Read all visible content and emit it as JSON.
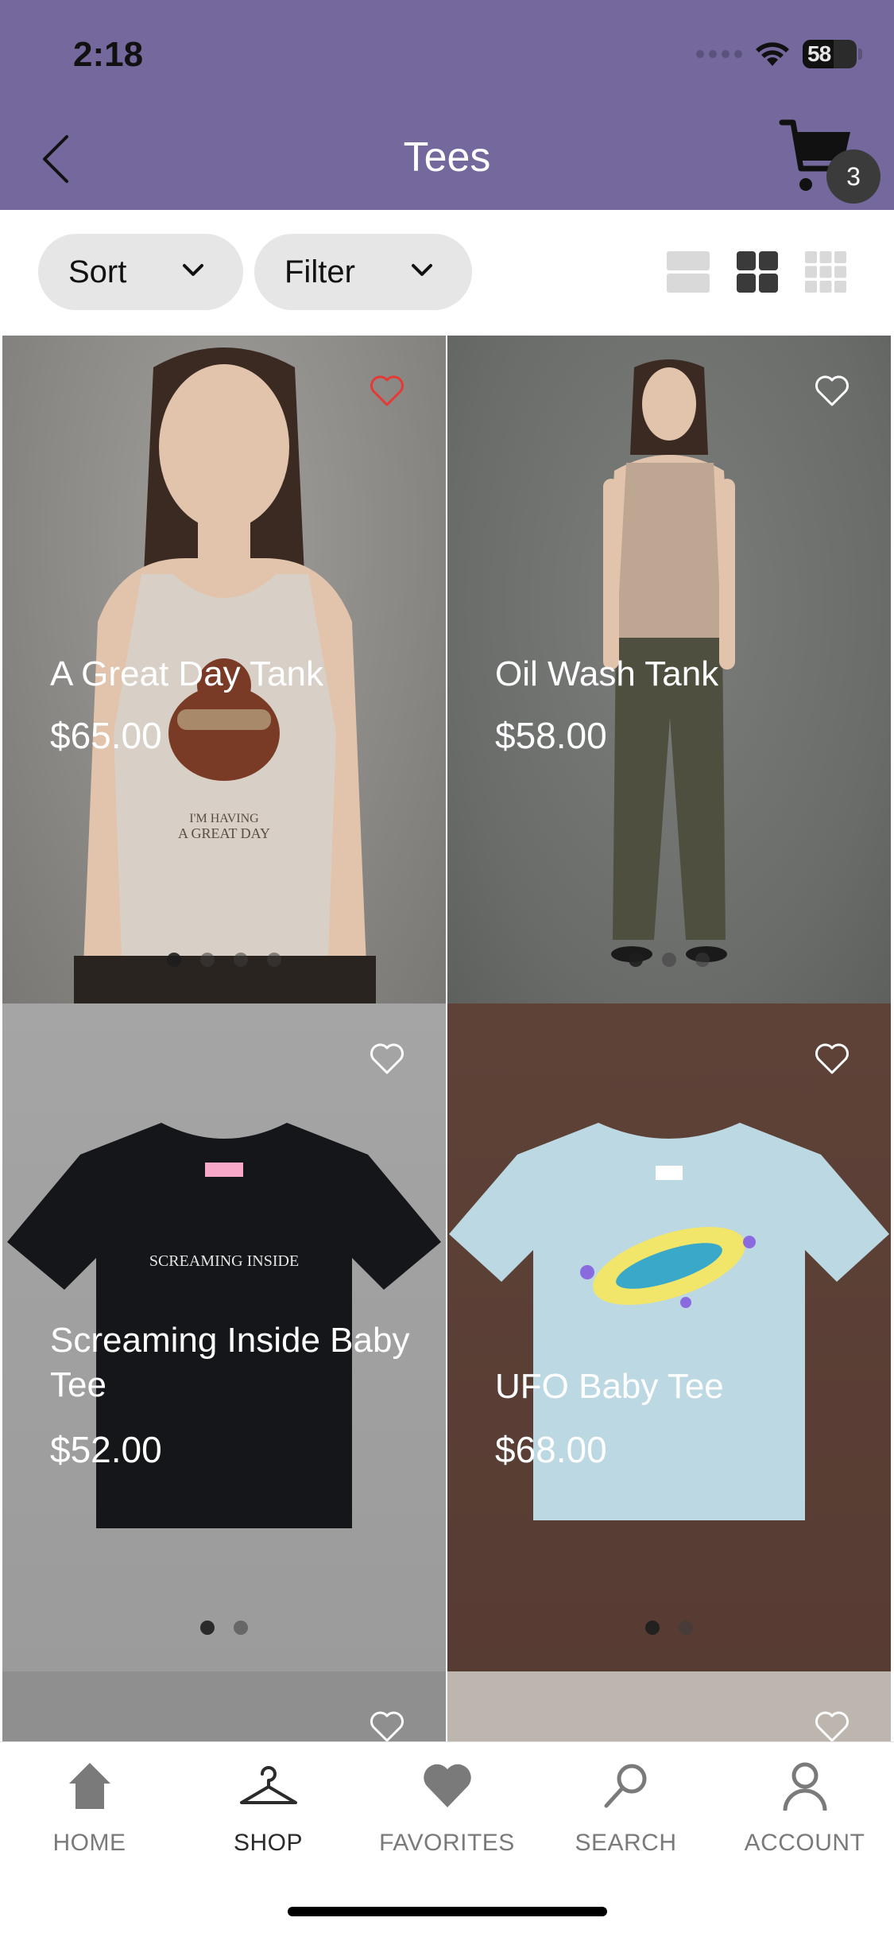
{
  "status_bar": {
    "time": "2:18",
    "battery": "58"
  },
  "header": {
    "title": "Tees",
    "cart_count": "3",
    "back_icon": "chevron-left-icon",
    "cart_icon": "cart-icon"
  },
  "toolbar": {
    "sort_label": "Sort",
    "filter_label": "Filter",
    "view_modes": [
      "single-column-view-icon",
      "two-column-grid-icon",
      "three-column-grid-icon"
    ],
    "active_view": "two-column-grid-icon"
  },
  "products": [
    {
      "name": "A Great Day Tank",
      "price": "$65.00",
      "favorited": true,
      "image_slides": 4,
      "active_slide": 1,
      "bg_color": "#8d8b87"
    },
    {
      "name": "Oil Wash Tank",
      "price": "$58.00",
      "favorited": false,
      "image_slides": 3,
      "active_slide": 1,
      "bg_color": "#6f716f"
    },
    {
      "name": "Screaming Inside Baby Tee",
      "price": "$52.00",
      "favorited": false,
      "image_slides": 2,
      "active_slide": 1,
      "bg_color": "#9f9f9f"
    },
    {
      "name": "UFO Baby Tee",
      "price": "$68.00",
      "favorited": false,
      "image_slides": 2,
      "active_slide": 1,
      "bg_color": "#5b4037"
    }
  ],
  "shirt_prints": {
    "screaming": "SCREAMING INSIDE"
  },
  "bottom_nav": [
    {
      "label": "HOME",
      "icon": "home-icon"
    },
    {
      "label": "SHOP",
      "icon": "hanger-icon",
      "active": true
    },
    {
      "label": "FAVORITES",
      "icon": "heart-icon"
    },
    {
      "label": "SEARCH",
      "icon": "search-icon"
    },
    {
      "label": "ACCOUNT",
      "icon": "person-icon"
    }
  ],
  "colors": {
    "header_bg": "#74689c",
    "pill_bg": "#e6e6e6",
    "favorite_red": "#e53935"
  }
}
